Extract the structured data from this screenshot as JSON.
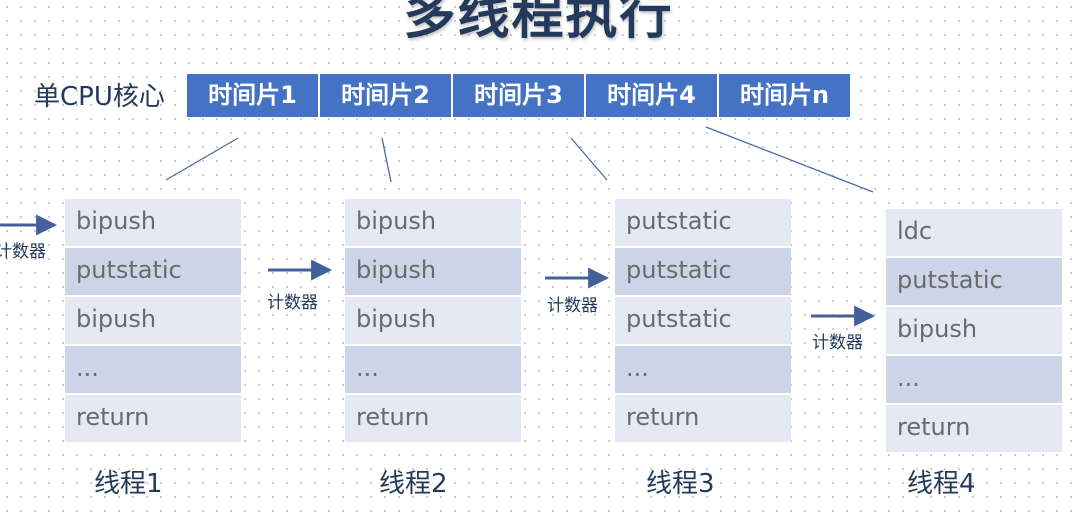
{
  "title": "多线程执行",
  "cpu_label": "单CPU核心",
  "time_slices": [
    "时间片1",
    "时间片2",
    "时间片3",
    "时间片4",
    "时间片n"
  ],
  "counter_label": "计数器",
  "threads": [
    {
      "name": "线程1",
      "instructions": [
        "bipush",
        "putstatic",
        "bipush",
        "...",
        "return"
      ]
    },
    {
      "name": "线程2",
      "instructions": [
        "bipush",
        "bipush",
        "bipush",
        "...",
        "return"
      ]
    },
    {
      "name": "线程3",
      "instructions": [
        "putstatic",
        "putstatic",
        "putstatic",
        "...",
        "return"
      ]
    },
    {
      "name": "线程4",
      "instructions": [
        "ldc",
        "putstatic",
        "bipush",
        "...",
        "return"
      ]
    }
  ],
  "colors": {
    "slice_fill": "#4472c4",
    "row_light": "#e6e9f3",
    "row_dark": "#ccd4e8",
    "text_dark": "#243a5c",
    "arrow": "#44609a"
  }
}
